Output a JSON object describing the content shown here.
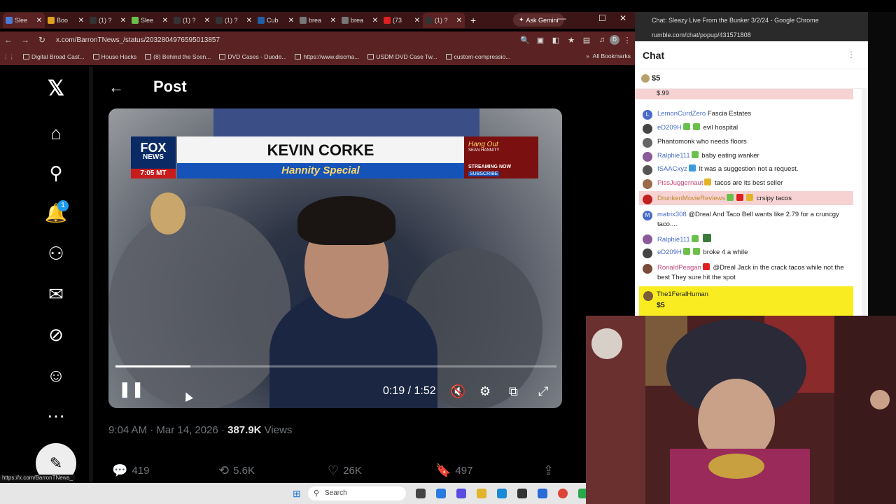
{
  "browser": {
    "tabs": [
      {
        "label": "Slee",
        "color": "#4a7bd6"
      },
      {
        "label": "Boo",
        "color": "#e0a020"
      },
      {
        "label": "(1) ?",
        "color": "#333333"
      },
      {
        "label": "Slee",
        "color": "#6ac04a"
      },
      {
        "label": "(1) ?",
        "color": "#333333"
      },
      {
        "label": "(1) ?",
        "color": "#333333"
      },
      {
        "label": "Cub",
        "color": "#1f5fa8"
      },
      {
        "label": "brea",
        "color": "#777777"
      },
      {
        "label": "brea",
        "color": "#777777"
      },
      {
        "label": "(73",
        "color": "#e02020"
      },
      {
        "label": "(1) ?",
        "color": "#333333"
      }
    ],
    "gemini_label": "Ask Gemini",
    "url": "x.com/BarronTNews_/status/2032804976595013857",
    "bookmarks": [
      "Digital Broad Cast...",
      "House Hacks",
      "(8) Behind the Scen...",
      "DVD Cases - Duode...",
      "https://www.discma...",
      "USDM DVD Case Tw...",
      "custom-compressio..."
    ],
    "all_bookmarks": "All Bookmarks",
    "status_url": "https://x.com/BarronTNews_"
  },
  "x": {
    "page_title": "Post",
    "notifications_count": "1",
    "video": {
      "network": "FOX",
      "network_sub": "NEWS",
      "clock": "7:05 MT",
      "name": "KEVIN CORKE",
      "show": "Hannity Special",
      "promo_title": "Hang Out",
      "promo_sub": "SEAN HANNITY",
      "promo_streaming": "STREAMING NOW",
      "promo_subscribe": "SUBSCRIBE",
      "time": "0:19 / 1:52",
      "progress": 0.17
    },
    "meta": {
      "time": "9:04 AM",
      "date": "Mar 14, 2026",
      "views_count": "387.9K",
      "views_label": "Views"
    },
    "actions": {
      "replies": "419",
      "reposts": "5.6K",
      "likes": "26K",
      "bookmarks": "497"
    }
  },
  "chat_window": {
    "title_bar": "Chat: Sleazy Live From the Bunker 3/2/24 - Google Chrome",
    "url": "rumble.com/chat/popup/431571808",
    "title": "Chat",
    "pinned_amount": "$5",
    "top_rant_amount": "$.99",
    "messages": [
      {
        "user": "LemonCurdZero",
        "text": "Fascia Estates",
        "user_color": "#4a6cc7",
        "avatar": "#4a6cc7",
        "initial": "L"
      },
      {
        "user": "eD209H",
        "text": "evil hospital",
        "user_color": "#4a6cc7",
        "avatar": "#444444",
        "initial": ""
      },
      {
        "user": "Phantomonk",
        "text": "who needs floors",
        "user_color": "#222222",
        "avatar": "#666666",
        "initial": ""
      },
      {
        "user": "Ralphie111",
        "text": "baby eating wanker",
        "user_color": "#4a6cc7",
        "avatar": "#8a5a9a",
        "initial": ""
      },
      {
        "user": "ISAACxyz",
        "text": "It was a suggestion not a request.",
        "user_color": "#4a6cc7",
        "avatar": "#555555",
        "initial": ""
      },
      {
        "user": "PissJuggernaut",
        "text": "tacos are its best seller",
        "user_color": "#c04a7a",
        "avatar": "#9a6a4a",
        "initial": ""
      },
      {
        "user": "DrunkenMovieReviews",
        "text": "crsipy tacos",
        "user_color": "#c08a2a",
        "avatar": "#c02020",
        "initial": ""
      },
      {
        "user": "matrix308",
        "text": "@Dreal And Taco Bell wants like 2.79 for a cruncgy taco....",
        "user_color": "#4a6cc7",
        "avatar": "#4a6cc7",
        "initial": "M"
      },
      {
        "user": "Ralphie111",
        "text": "",
        "user_color": "#4a6cc7",
        "avatar": "#8a5a9a",
        "initial": ""
      },
      {
        "user": "eD209H",
        "text": "broke 4 a while",
        "user_color": "#4a6cc7",
        "avatar": "#444444",
        "initial": ""
      },
      {
        "user": "RonaldPeagan",
        "text": "@Dreal Jack in the crack tacos while not the best They sure hit the spot",
        "user_color": "#c04a7a",
        "avatar": "#7a4a3a",
        "initial": ""
      }
    ],
    "rant": {
      "user": "The1FeralHuman",
      "amount": "$5"
    }
  },
  "taskbar": {
    "search_label": "Search"
  }
}
